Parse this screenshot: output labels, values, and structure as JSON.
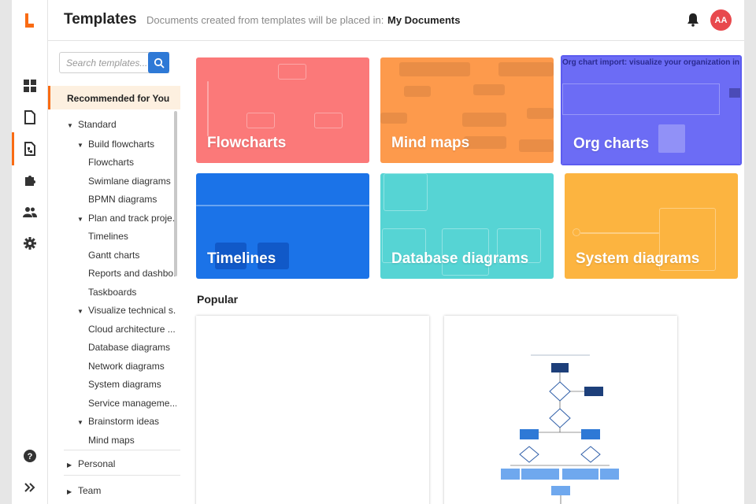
{
  "header": {
    "title": "Templates",
    "subtitle": "Documents created from templates will be placed in:",
    "destination": "My Documents",
    "avatar_initials": "AA"
  },
  "rail": {
    "icons": [
      "logo-icon",
      "dashboard-icon",
      "document-icon",
      "templates-icon",
      "integrations-icon",
      "team-icon",
      "settings-icon",
      "help-icon",
      "expand-icon"
    ]
  },
  "sidebar": {
    "search_placeholder": "Search templates...",
    "recommended": "Recommended for You",
    "standard": "Standard",
    "build_flowcharts": "Build flowcharts",
    "flowcharts": "Flowcharts",
    "swimlane": "Swimlane diagrams",
    "bpmn": "BPMN diagrams",
    "plan_track": "Plan and track proje...",
    "timelines": "Timelines",
    "gantt": "Gantt charts",
    "reports": "Reports and dashbo...",
    "taskboards": "Taskboards",
    "visualize": "Visualize technical s...",
    "cloud": "Cloud architecture ...",
    "database": "Database diagrams",
    "network": "Network diagrams",
    "system": "System diagrams",
    "service": "Service manageme...",
    "brainstorm": "Brainstorm ideas",
    "mindmaps": "Mind maps",
    "personal": "Personal",
    "team": "Team"
  },
  "cards": [
    {
      "label": "Flowcharts",
      "color": "#fb7979"
    },
    {
      "label": "Mind maps",
      "color": "#fd9a4c"
    },
    {
      "label": "Org charts",
      "color": "#6c6cf5",
      "banner": "Org chart import: visualize your organization in se"
    },
    {
      "label": "Timelines",
      "color": "#1b73e8"
    },
    {
      "label": "Database diagrams",
      "color": "#56d4d4"
    },
    {
      "label": "System diagrams",
      "color": "#fcb440"
    }
  ],
  "popular": {
    "heading": "Popular"
  },
  "colors": {
    "accent": "#f96b13",
    "primary": "#2e79d6",
    "avatar": "#e8494d"
  }
}
